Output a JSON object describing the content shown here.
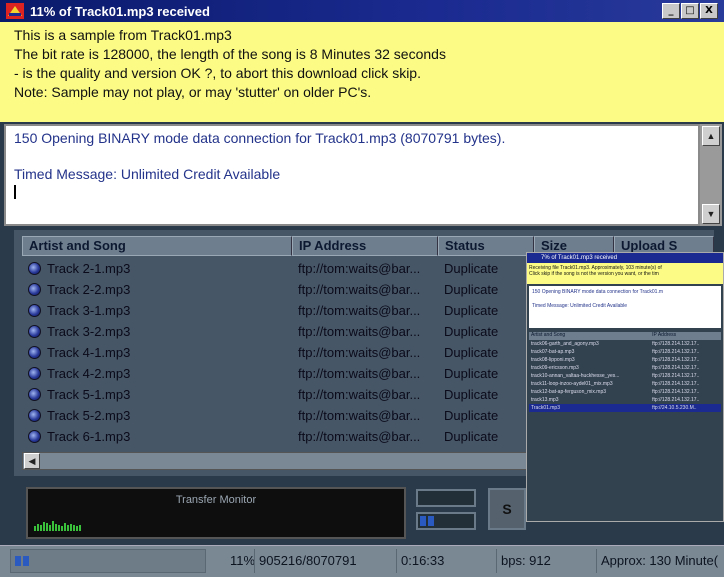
{
  "window": {
    "title": "11% of Track01.mp3 received",
    "controls": {
      "minimize": "_",
      "maximize": "□",
      "close": "X"
    }
  },
  "info_lines": [
    "This is a sample from Track01.mp3",
    "The bit rate is 128000, the length of the song is 8 Minutes 32 seconds",
    "- is the quality and version OK ?, to abort this download click skip.",
    "Note: Sample may not play, or may 'stutter' on older PC's."
  ],
  "log": {
    "line1": "150 Opening BINARY mode data connection for Track01.mp3 (8070791 bytes).",
    "line2": "Timed Message: Unlimited Credit Available"
  },
  "table": {
    "columns": [
      "Artist and Song",
      "IP Address",
      "Status",
      "Size",
      "Upload S"
    ],
    "rows": [
      {
        "song": "Track 2-1.mp3",
        "ip": "ftp://tom:waits@bar...",
        "status": "Duplicate"
      },
      {
        "song": "Track 2-2.mp3",
        "ip": "ftp://tom:waits@bar...",
        "status": "Duplicate"
      },
      {
        "song": "Track 3-1.mp3",
        "ip": "ftp://tom:waits@bar...",
        "status": "Duplicate"
      },
      {
        "song": "Track 3-2.mp3",
        "ip": "ftp://tom:waits@bar...",
        "status": "Duplicate"
      },
      {
        "song": "Track 4-1.mp3",
        "ip": "ftp://tom:waits@bar...",
        "status": "Duplicate"
      },
      {
        "song": "Track 4-2.mp3",
        "ip": "ftp://tom:waits@bar...",
        "status": "Duplicate"
      },
      {
        "song": "Track 5-1.mp3",
        "ip": "ftp://tom:waits@bar...",
        "status": "Duplicate"
      },
      {
        "song": "Track 5-2.mp3",
        "ip": "ftp://tom:waits@bar...",
        "status": "Duplicate"
      },
      {
        "song": "Track 6-1.mp3",
        "ip": "ftp://tom:waits@bar...",
        "status": "Duplicate"
      }
    ]
  },
  "inset": {
    "title": "7% of Track01.mp3 received",
    "info1": "Receiving file Track01.mp3. Approximately, 103 minute(s) of",
    "info2": "Click skip if the song is not the version you want, or the tim",
    "log1": "150 Opening BINARY mode data connection for Track01.m",
    "log2": "Timed Message: Unlimited Credit Available",
    "columns": [
      "Artist and Song",
      "IP Address"
    ],
    "rows": [
      {
        "song": "track06-garth_and_agony.mp3",
        "ip": "ftp://128.214.132.17.."
      },
      {
        "song": "track07-bat-ap.mp3",
        "ip": "ftp://128.214.132.17.."
      },
      {
        "song": "track08-lipponi.mp3",
        "ip": "ftp://128.214.132.17.."
      },
      {
        "song": "track09-ericsson.mp3",
        "ip": "ftp://128.214.132.17.."
      },
      {
        "song": "track10-annan_valtaa-huckhesse_yes...",
        "ip": "ftp://128.214.132.17.."
      },
      {
        "song": "track11-loop-inzoo-aydel01_mix.mp3",
        "ip": "ftp://128.214.132.17.."
      },
      {
        "song": "track12-bat-ap-ferguson_mix.mp3",
        "ip": "ftp://128.214.132.17.."
      },
      {
        "song": "track13.mp3",
        "ip": "ftp://128.214.132.17.."
      },
      {
        "song": "Track01.mp3",
        "ip": "ftp://24.10.5.230.M.."
      }
    ]
  },
  "monitor": {
    "label": "Transfer Monitor",
    "levels": [
      0.25,
      0.35,
      0.3,
      0.45,
      0.4,
      0.3,
      0.5,
      0.35,
      0.3,
      0.25,
      0.4,
      0.3,
      0.35,
      0.3,
      0.25,
      0.3
    ]
  },
  "side_button": "S",
  "status": {
    "percent": "11%",
    "bytes": "905216/8070791",
    "elapsed": "0:16:33",
    "speed": "bps: 912",
    "remaining": "Approx: 130 Minute("
  }
}
